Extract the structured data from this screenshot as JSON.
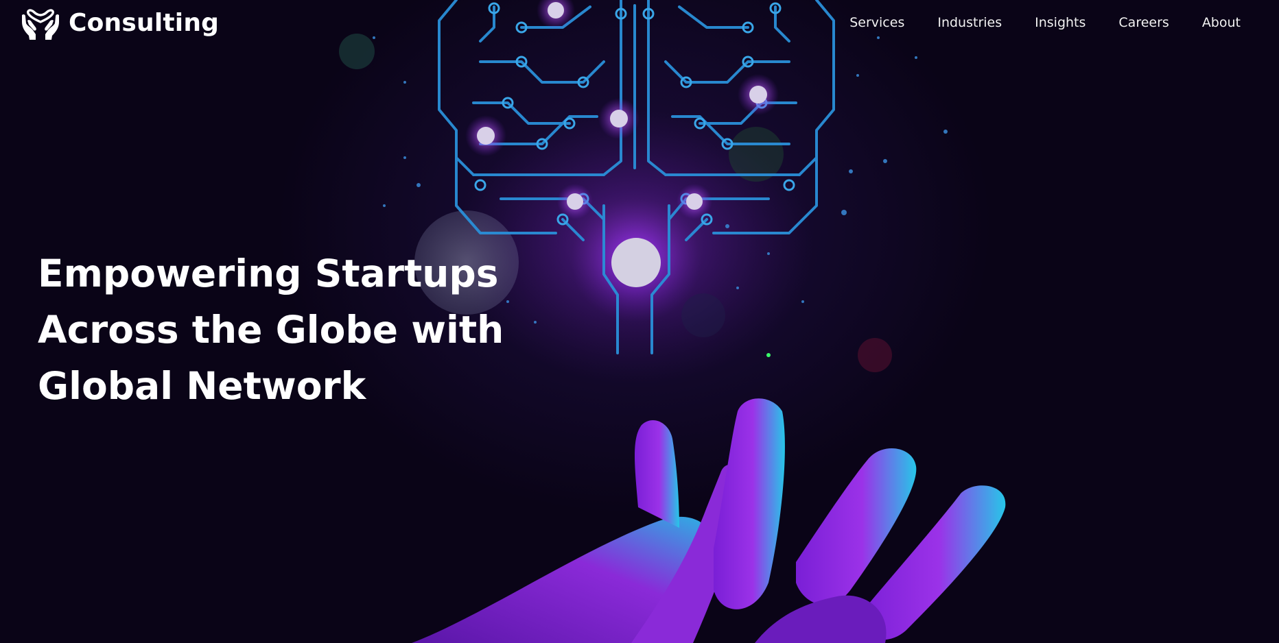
{
  "brand": {
    "name": "Consulting",
    "logo_icon": "hands-heart-icon"
  },
  "nav": {
    "items": [
      {
        "label": "Services"
      },
      {
        "label": "Industries"
      },
      {
        "label": "Insights"
      },
      {
        "label": "Careers"
      },
      {
        "label": "About"
      }
    ]
  },
  "hero": {
    "headline": "Empowering Startups Across the Globe with Global Network",
    "background_image": "ai-brain-circuit-over-neon-hand",
    "colors": {
      "background": "#0b0519",
      "circuit_blue": "#2b9be0",
      "glow_purple": "#a53cf0",
      "hand_cyan": "#22c4e6",
      "text": "#ffffff"
    }
  }
}
